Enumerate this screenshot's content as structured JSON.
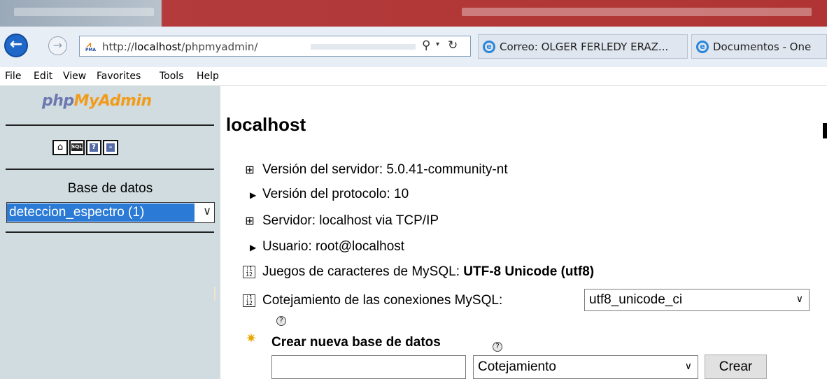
{
  "browser": {
    "url_prefix": "http://",
    "url_host": "localhost",
    "url_path": "/phpmyadmin/",
    "favicon_text": "PMA",
    "tabs": [
      {
        "label": "Correo: OLGER FERLEDY ERAZ..."
      },
      {
        "label": "Documentos - One"
      }
    ]
  },
  "menu": [
    "File",
    "Edit",
    "View",
    "Favorites",
    "Tools",
    "Help"
  ],
  "left": {
    "logo": {
      "php": "php",
      "my": "My",
      "admin": "Admin"
    },
    "nav_icons": {
      "sql": "SQL",
      "help": "?"
    },
    "db_label": "Base de datos",
    "db_selected": "deteccion_espectro (1)"
  },
  "main": {
    "title": "localhost",
    "server_version": "Versión del servidor: 5.0.41-community-nt",
    "protocol_version": "Versión del protocolo: 10",
    "server": "Servidor: localhost via TCP/IP",
    "user": "Usuario: root@localhost",
    "charset_label": "Juegos de caracteres de MySQL: ",
    "charset_value": "UTF-8 Unicode (utf8)",
    "collation_label": "Cotejamiento de las conexiones MySQL:",
    "collation_value": "utf8_unicode_ci",
    "create_db_title": "Crear nueva base de datos",
    "create_db_collation_placeholder": "Cotejamiento",
    "create_button": "Crear"
  },
  "colors": {
    "left_frame_bg": "#d0dce0",
    "select_highlight": "#2a7ad6",
    "logo_blue": "#6c78af",
    "logo_orange": "#f29b1a"
  },
  "icons": [
    "back-arrow-icon",
    "forward-arrow-icon",
    "search-icon",
    "refresh-icon",
    "ie-icon",
    "home-icon",
    "sql-icon",
    "help-icon",
    "query-window-icon",
    "server-icon",
    "triangle-bullet-icon",
    "charset-icon",
    "new-database-icon"
  ]
}
